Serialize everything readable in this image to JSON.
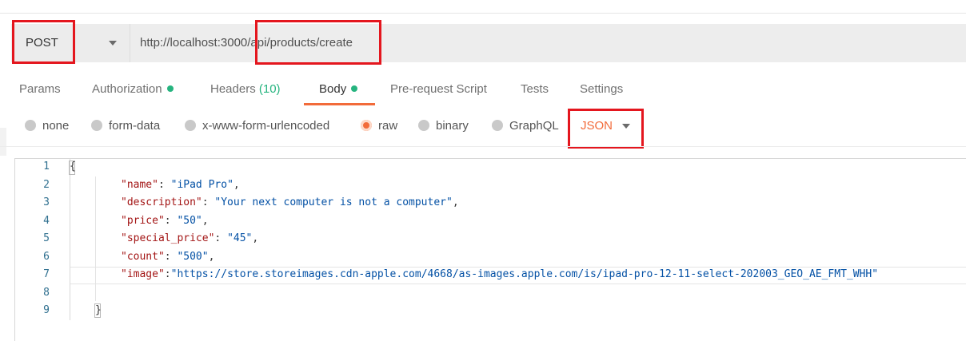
{
  "request": {
    "method": "POST",
    "url": "http://localhost:3000/api/products/create"
  },
  "tabs": [
    {
      "label": "Params"
    },
    {
      "label": "Authorization"
    },
    {
      "label": "Headers",
      "count": "(10)"
    },
    {
      "label": "Body"
    },
    {
      "label": "Pre-request Script"
    },
    {
      "label": "Tests"
    },
    {
      "label": "Settings"
    }
  ],
  "body_types": [
    "none",
    "form-data",
    "x-www-form-urlencoded",
    "raw",
    "binary",
    "GraphQL"
  ],
  "selected_body_type": "raw",
  "format": "JSON",
  "editor": {
    "line_numbers": [
      "1",
      "2",
      "3",
      "4",
      "5",
      "6",
      "7",
      "8",
      "9"
    ],
    "open_brace": "{",
    "close_brace": "}",
    "fields": [
      {
        "key": "\"name\"",
        "value": "\"iPad Pro\"",
        "sep": ": ",
        "end": ","
      },
      {
        "key": "\"description\"",
        "value": "\"Your next computer is not a computer\"",
        "sep": ": ",
        "end": ","
      },
      {
        "key": "\"price\"",
        "value": "\"50\"",
        "sep": ": ",
        "end": ","
      },
      {
        "key": "\"special_price\"",
        "value": "\"45\"",
        "sep": ": ",
        "end": ","
      },
      {
        "key": "\"count\"",
        "value": "\"500\"",
        "sep": ": ",
        "end": ","
      },
      {
        "key": "\"image\"",
        "value": "\"https://store.storeimages.cdn-apple.com/4668/as-images.apple.com/is/ipad-pro-12-11-select-202003_GEO_AE_FMT_WHH\"",
        "sep": ":",
        "end": ""
      }
    ]
  },
  "colors": {
    "accent": "#f26b3a",
    "status_dot": "#26b47f",
    "highlight": "#e4161e",
    "json_key": "#a31515",
    "json_string": "#0451a5"
  }
}
